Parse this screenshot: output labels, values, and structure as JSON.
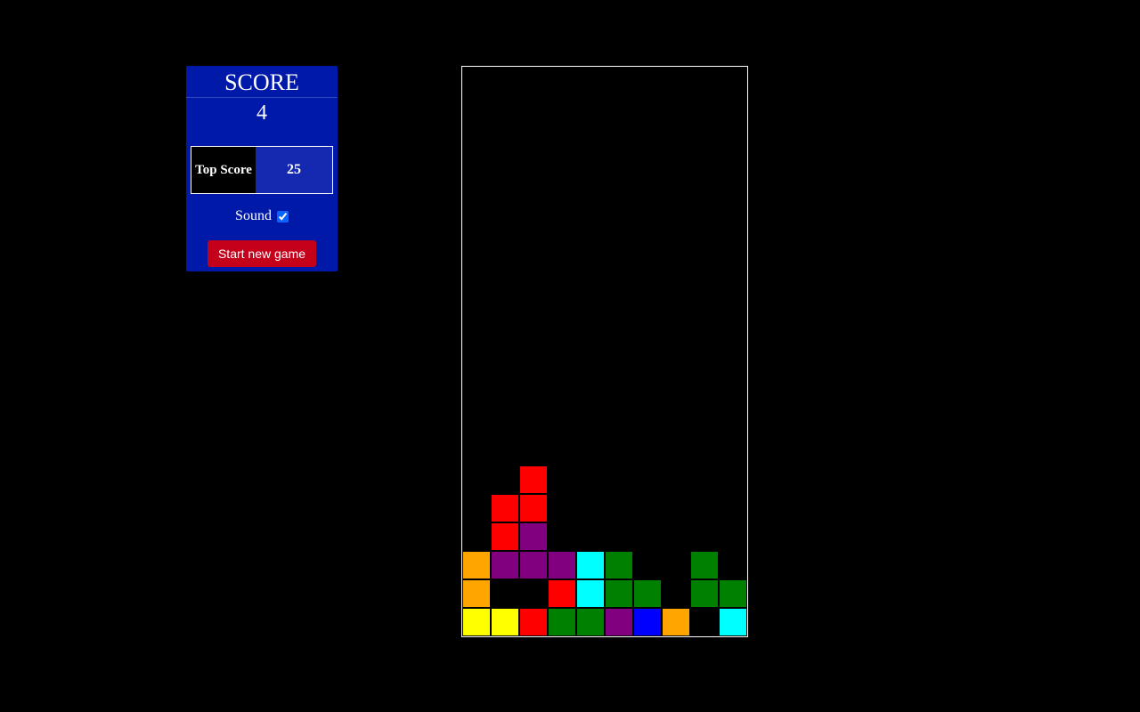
{
  "score_panel": {
    "title": "SCORE",
    "score": "4",
    "top_score_label": "Top Score",
    "top_score": "25",
    "sound_label": "Sound",
    "sound_enabled": true,
    "start_button_label": "Start new game"
  },
  "board": {
    "columns": 10,
    "rows": 20,
    "colors": {
      "R": "#ff0000",
      "P": "#800080",
      "O": "#ffa500",
      "C": "#00ffff",
      "G": "#008000",
      "Y": "#ffff00",
      "B": "#0000ff"
    },
    "cells": [
      {
        "col": 2,
        "row": 14,
        "color": "R"
      },
      {
        "col": 1,
        "row": 15,
        "color": "R"
      },
      {
        "col": 2,
        "row": 15,
        "color": "R"
      },
      {
        "col": 1,
        "row": 16,
        "color": "R"
      },
      {
        "col": 2,
        "row": 16,
        "color": "P"
      },
      {
        "col": 0,
        "row": 17,
        "color": "O"
      },
      {
        "col": 1,
        "row": 17,
        "color": "P"
      },
      {
        "col": 2,
        "row": 17,
        "color": "P"
      },
      {
        "col": 3,
        "row": 17,
        "color": "P"
      },
      {
        "col": 4,
        "row": 17,
        "color": "C"
      },
      {
        "col": 5,
        "row": 17,
        "color": "G"
      },
      {
        "col": 8,
        "row": 17,
        "color": "G"
      },
      {
        "col": 0,
        "row": 18,
        "color": "O"
      },
      {
        "col": 3,
        "row": 18,
        "color": "R"
      },
      {
        "col": 4,
        "row": 18,
        "color": "C"
      },
      {
        "col": 5,
        "row": 18,
        "color": "G"
      },
      {
        "col": 6,
        "row": 18,
        "color": "G"
      },
      {
        "col": 8,
        "row": 18,
        "color": "G"
      },
      {
        "col": 9,
        "row": 18,
        "color": "G"
      },
      {
        "col": 0,
        "row": 19,
        "color": "Y"
      },
      {
        "col": 1,
        "row": 19,
        "color": "Y"
      },
      {
        "col": 2,
        "row": 19,
        "color": "R"
      },
      {
        "col": 3,
        "row": 19,
        "color": "G"
      },
      {
        "col": 4,
        "row": 19,
        "color": "G"
      },
      {
        "col": 5,
        "row": 19,
        "color": "P"
      },
      {
        "col": 6,
        "row": 19,
        "color": "B"
      },
      {
        "col": 7,
        "row": 19,
        "color": "O"
      },
      {
        "col": 9,
        "row": 19,
        "color": "C"
      }
    ]
  }
}
